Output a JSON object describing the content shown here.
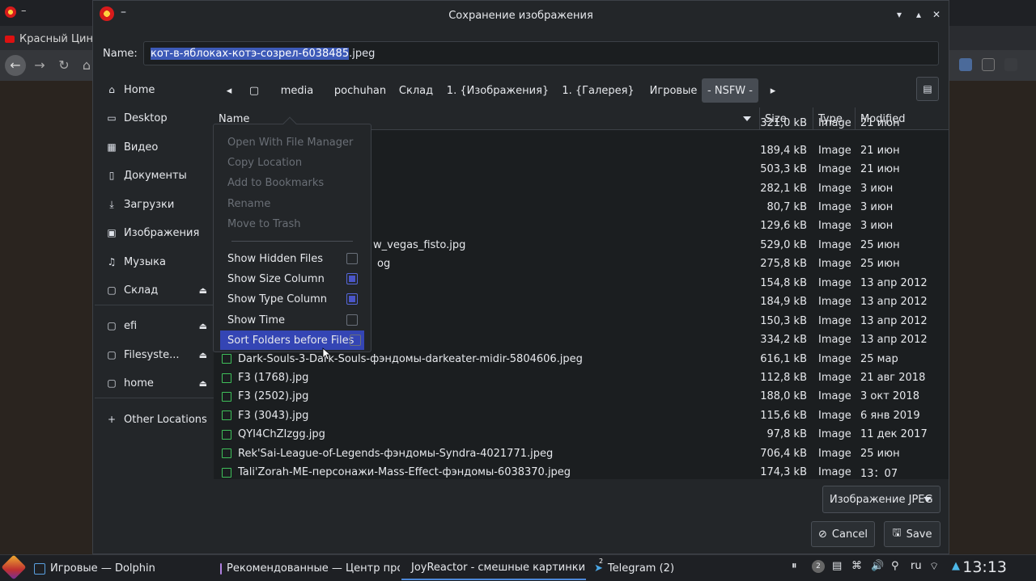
{
  "background_browser": {
    "tab_title": "Красный Цин"
  },
  "dialog": {
    "title": "Сохранение изображения",
    "title_dash": "–",
    "name_label": "Name:",
    "filename_selected": "кот-в-яблоках-котэ-созрел-6038485",
    "filename_ext": ".jpeg",
    "sidebar": {
      "places": [
        {
          "label": "Home",
          "icon": "home-icon"
        },
        {
          "label": "Desktop",
          "icon": "desktop-icon"
        },
        {
          "label": "Видео",
          "icon": "video-icon"
        },
        {
          "label": "Документы",
          "icon": "documents-icon"
        },
        {
          "label": "Загрузки",
          "icon": "download-icon"
        },
        {
          "label": "Изображения",
          "icon": "pictures-icon"
        },
        {
          "label": "Музыка",
          "icon": "music-icon"
        },
        {
          "label": "Склад",
          "icon": "drive-icon",
          "eject": true
        }
      ],
      "devices": [
        {
          "label": "efi",
          "icon": "drive-icon",
          "eject": true
        },
        {
          "label": "Filesyste...",
          "icon": "drive-icon",
          "eject": true
        },
        {
          "label": "home",
          "icon": "drive-icon",
          "eject": true
        }
      ],
      "other": {
        "label": "Other Locations",
        "icon": "plus-icon"
      }
    },
    "pathbar": {
      "crumbs": [
        "media",
        "pochuhan",
        "Склад",
        "1. {Изображения}",
        "1. {Галерея}",
        "Игровые",
        "- NSFW -"
      ],
      "active_index": 6
    },
    "columns": {
      "name": "Name",
      "size": "Size",
      "type": "Type",
      "modified": "Modified"
    },
    "rows": [
      {
        "name": "",
        "size": "321,0 kB",
        "type": "Image",
        "modified": "21 июн"
      },
      {
        "name": "",
        "size": "189,4 kB",
        "type": "Image",
        "modified": "21 июн"
      },
      {
        "name": "",
        "size": "503,3 kB",
        "type": "Image",
        "modified": "21 июн"
      },
      {
        "name": "",
        "size": "282,1 kB",
        "type": "Image",
        "modified": "3 июн"
      },
      {
        "name": "",
        "size": "80,7 kB",
        "type": "Image",
        "modified": "3 июн"
      },
      {
        "name": "",
        "size": "129,6 kB",
        "type": "Image",
        "modified": "3 июн"
      },
      {
        "name": "w_vegas_fisto.jpg",
        "size": "529,0 kB",
        "type": "Image",
        "modified": "25 июн"
      },
      {
        "name": "og",
        "size": "275,8 kB",
        "type": "Image",
        "modified": "25 июн"
      },
      {
        "name": "",
        "size": "154,8 kB",
        "type": "Image",
        "modified": "13 апр 2012"
      },
      {
        "name": "",
        "size": "184,9 kB",
        "type": "Image",
        "modified": "13 апр 2012"
      },
      {
        "name": "",
        "size": "150,3 kB",
        "type": "Image",
        "modified": "13 апр 2012"
      },
      {
        "name": "",
        "size": "334,2 kB",
        "type": "Image",
        "modified": "13 апр 2012"
      },
      {
        "name": "Dark-Souls-3-Dark-Souls-фэндомы-darkeater-midir-5804606.jpeg",
        "size": "616,1 kB",
        "type": "Image",
        "modified": "25 мар"
      },
      {
        "name": "F3 (1768).jpg",
        "size": "112,8 kB",
        "type": "Image",
        "modified": "21 авг 2018"
      },
      {
        "name": "F3 (2502).jpg",
        "size": "188,0 kB",
        "type": "Image",
        "modified": "3 окт 2018"
      },
      {
        "name": "F3 (3043).jpg",
        "size": "115,6 kB",
        "type": "Image",
        "modified": "6 янв 2019"
      },
      {
        "name": "QYI4ChZIzgg.jpg",
        "size": "97,8 kB",
        "type": "Image",
        "modified": "11 дек 2017"
      },
      {
        "name": "Rek'Sai-League-of-Legends-фэндомы-Syndra-4021771.jpeg",
        "size": "706,4 kB",
        "type": "Image",
        "modified": "25 июн"
      },
      {
        "name": "Tali'Zorah-ME-персонажи-Mass-Effect-фэндомы-6038370.jpeg",
        "size": "174,3 kB",
        "type": "Image",
        "modified": "13：07"
      }
    ],
    "context_menu": {
      "items": [
        {
          "label": "Open With File Manager",
          "disabled": true
        },
        {
          "label": "Copy Location",
          "disabled": true
        },
        {
          "label": "Add to Bookmarks",
          "disabled": true
        },
        {
          "label": "Rename",
          "disabled": true
        },
        {
          "label": "Move to Trash",
          "disabled": true
        }
      ],
      "toggles": [
        {
          "label": "Show Hidden Files",
          "checked": false
        },
        {
          "label": "Show Size Column",
          "checked": true
        },
        {
          "label": "Show Type Column",
          "checked": true
        },
        {
          "label": "Show Time",
          "checked": false
        },
        {
          "label": "Sort Folders before Files",
          "checked": false,
          "highlighted": true
        }
      ]
    },
    "filetype_select": "Изображение JPEG",
    "cancel_label": "Cancel",
    "save_label": "Save",
    "accent_color": "#3445b4"
  },
  "taskbar": {
    "tasks": [
      {
        "label": "Игровые — Dolphin"
      },
      {
        "label": "Рекомендованные — Центр про..."
      },
      {
        "label": "JoyReactor - смешные картинки ..."
      },
      {
        "label": "Telegram (2)",
        "badge": "2"
      }
    ],
    "tray_badge": "2",
    "language": "ru",
    "clock": "13:13"
  }
}
